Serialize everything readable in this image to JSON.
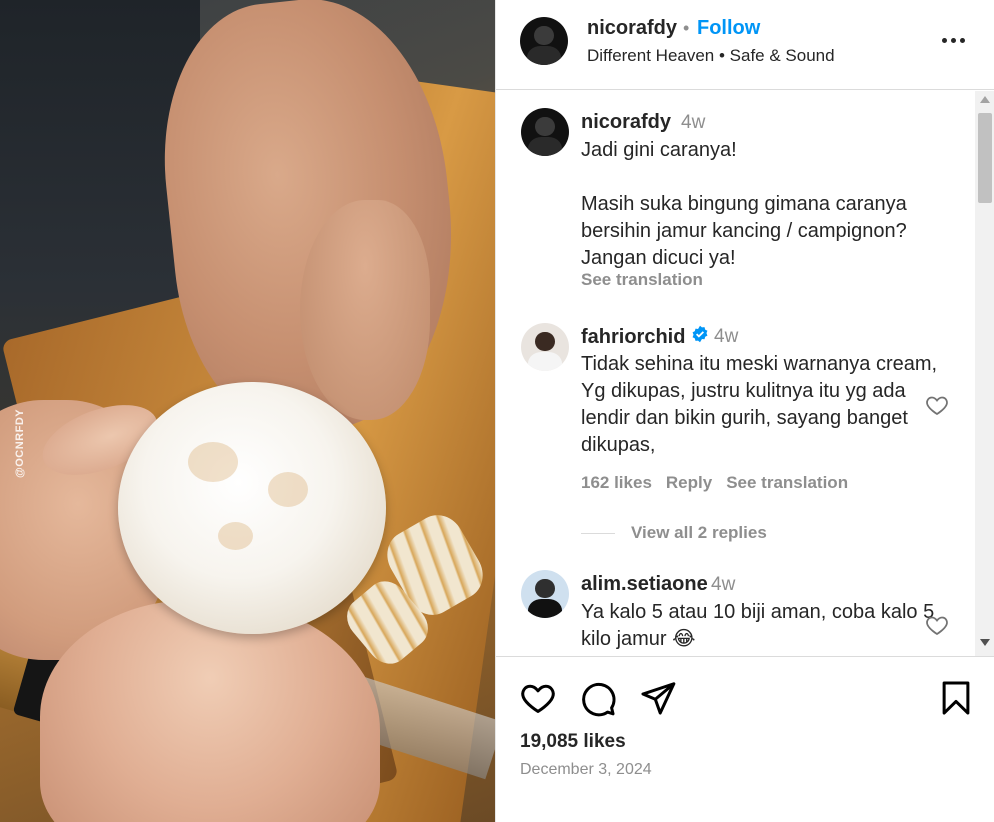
{
  "media": {
    "watermark": "@OCNRFDY"
  },
  "header": {
    "username": "nicorafdy",
    "separator": "•",
    "follow_label": "Follow",
    "audio": "Different Heaven • Safe & Sound"
  },
  "caption": {
    "username": "nicorafdy",
    "time": "4w",
    "text": "Jadi gini caranya!\n\nMasih suka bingung gimana caranya bersihin jamur kancing / campignon? Jangan dicuci ya!",
    "see_translation": "See translation"
  },
  "comments": [
    {
      "username": "fahriorchid",
      "verified": true,
      "time": "4w",
      "text": "Tidak sehina itu meski warnanya cream, Yg dikupas, justru kulitnya itu yg ada lendir dan bikin gurih, sayang banget dikupas,",
      "likes": "162 likes",
      "reply": "Reply",
      "see_translation": "See translation",
      "view_replies": "View all 2 replies"
    },
    {
      "username": "alim.setiaone",
      "verified": false,
      "time": "4w",
      "text": "Ya kalo 5 atau 10 biji aman, coba kalo 5 kilo jamur 😂"
    }
  ],
  "footer": {
    "likes": "19,085 likes",
    "date": "December 3, 2024"
  },
  "icons": {
    "like": "heart-icon",
    "comment": "comment-icon",
    "share": "paper-plane-icon",
    "save": "bookmark-icon",
    "more": "more-options-icon"
  },
  "colors": {
    "accent": "#0095f6",
    "text": "#262626",
    "muted": "#8e8e8e"
  }
}
